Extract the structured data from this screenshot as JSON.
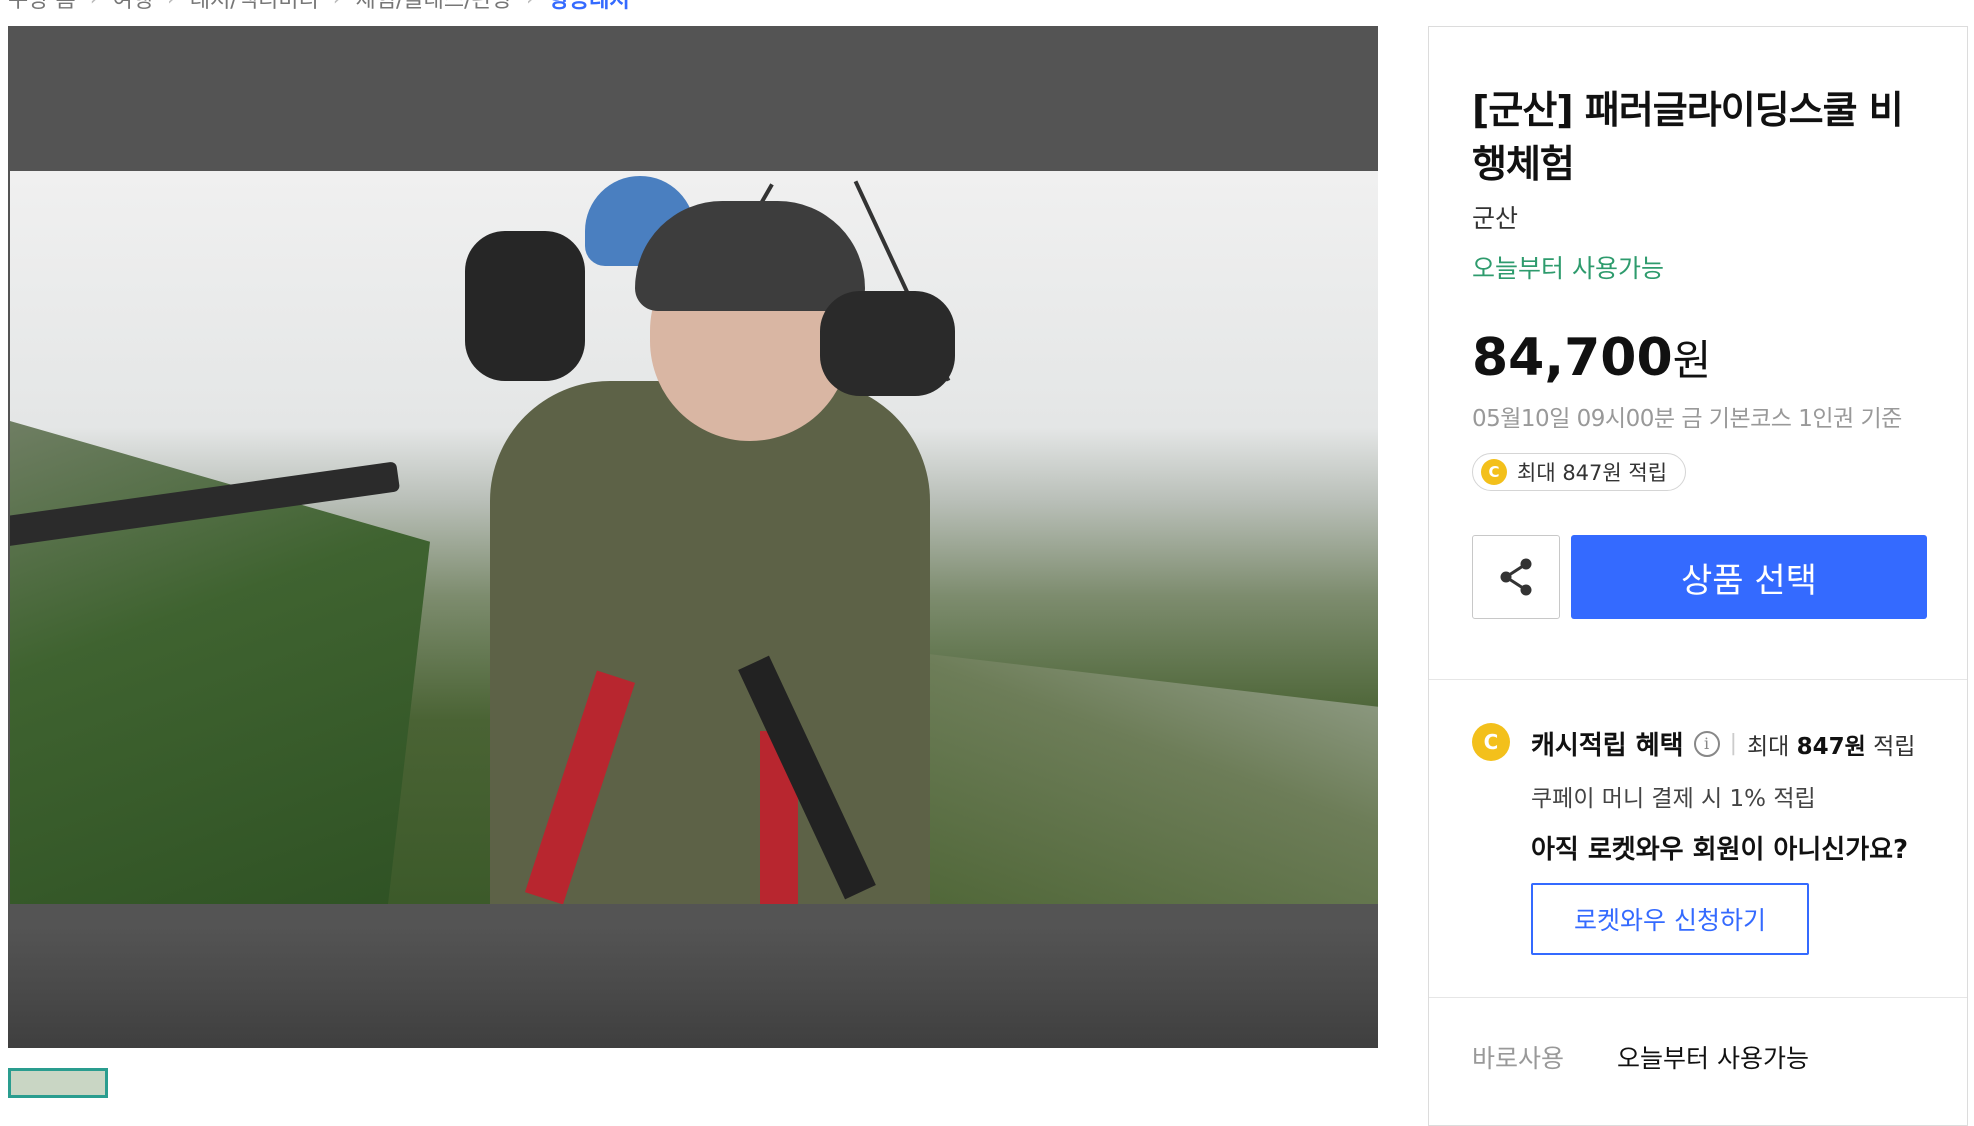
{
  "breadcrumb": {
    "items": [
      "쿠팡 홈",
      "여행",
      "레저/액티비티",
      "체험/클래스/관광",
      "항공레저"
    ]
  },
  "product": {
    "title": "[군산] 패러글라이딩스쿨 비행체험",
    "region": "군산",
    "availability": "오늘부터 사용가능",
    "price": "84,700",
    "currency": "원",
    "price_meta": "05월10일 09시00분 금 기본코스 1인권 기준",
    "cash_badge": "최대 847원 적립",
    "coin_letter": "C"
  },
  "actions": {
    "select_label": "상품 선택",
    "share_icon": "share-icon"
  },
  "benefit": {
    "title": "캐시적립 혜택",
    "info_glyph": "i",
    "separator": "|",
    "max_prefix": "최대",
    "max_amount": "847원",
    "max_suffix": "적립",
    "coupay": "쿠페이 머니 결제 시 1% 적립",
    "rocket_question": "아직 로켓와우 회원이 아니신가요?",
    "rocket_button": "로켓와우 신청하기"
  },
  "usage": {
    "label": "바로사용",
    "value": "오늘부터 사용가능"
  },
  "colors": {
    "accent_blue": "#346aff",
    "green": "#2e9b6d",
    "coin_yellow": "#f3c01b",
    "gallery_bg": "#545454"
  }
}
